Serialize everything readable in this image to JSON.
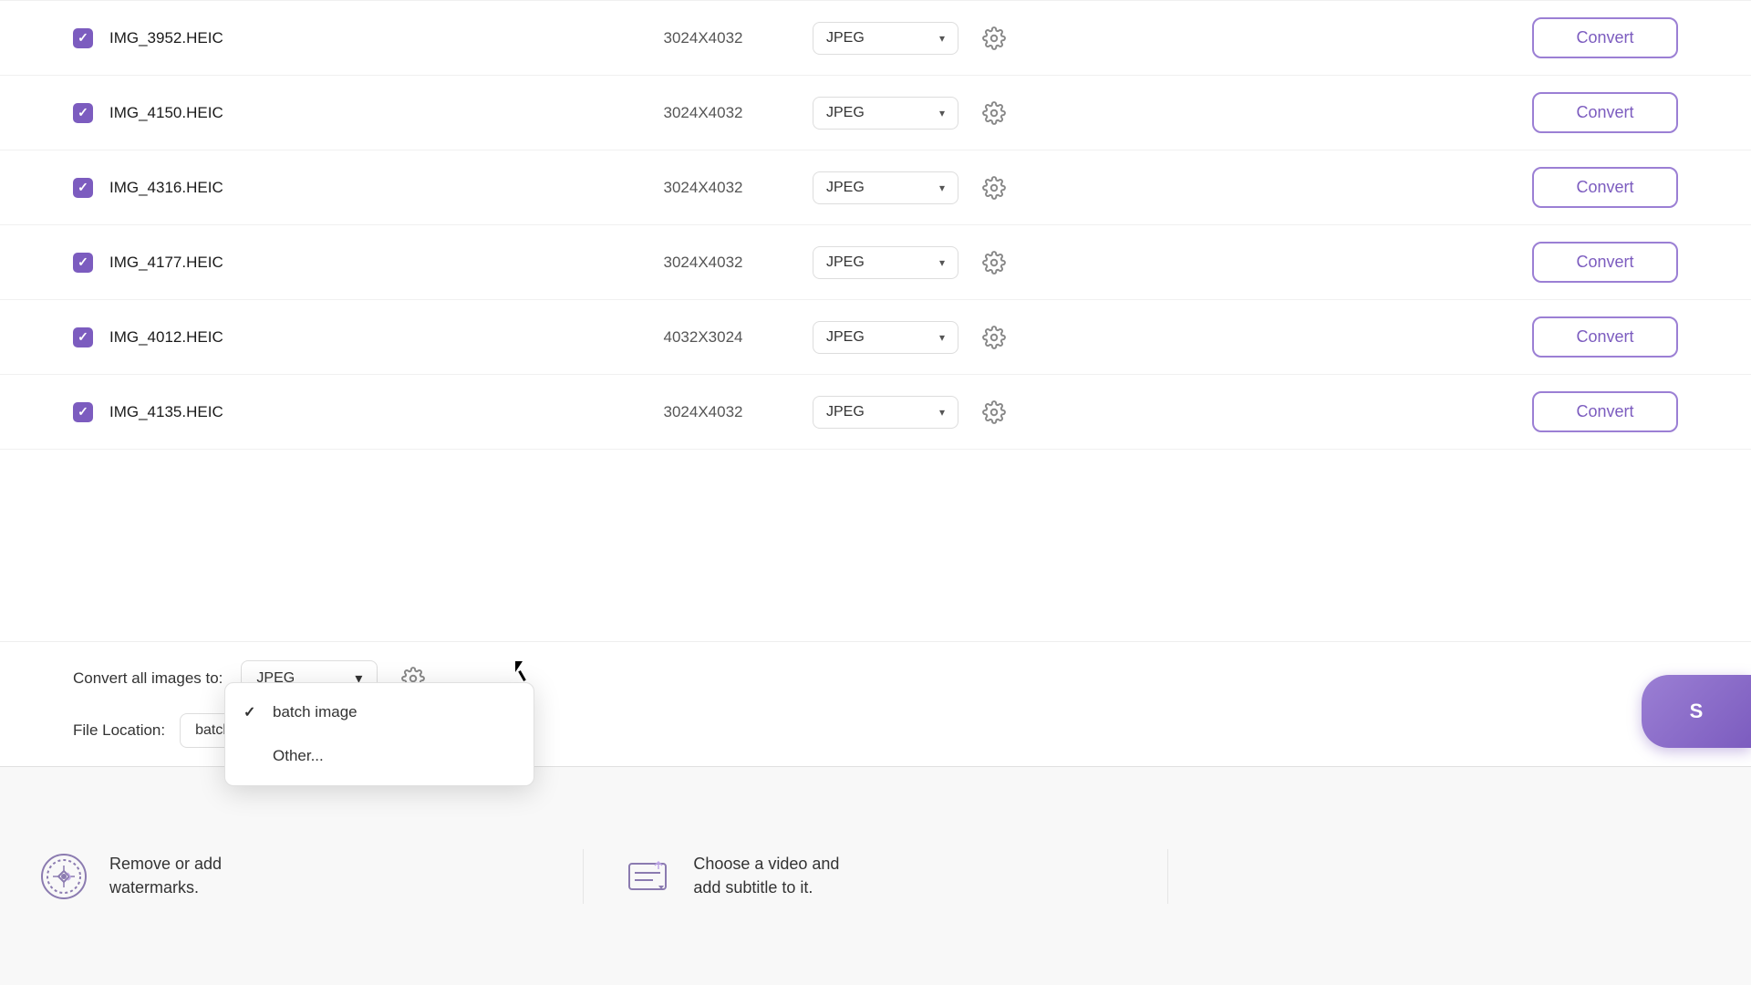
{
  "files": [
    {
      "id": 1,
      "name": "IMG_3952.HEIC",
      "dimensions": "3024X4032",
      "format": "JPEG"
    },
    {
      "id": 2,
      "name": "IMG_4150.HEIC",
      "dimensions": "3024X4032",
      "format": "JPEG"
    },
    {
      "id": 3,
      "name": "IMG_4316.HEIC",
      "dimensions": "3024X4032",
      "format": "JPEG"
    },
    {
      "id": 4,
      "name": "IMG_4177.HEIC",
      "dimensions": "3024X4032",
      "format": "JPEG"
    },
    {
      "id": 5,
      "name": "IMG_4012.HEIC",
      "dimensions": "4032X3024",
      "format": "JPEG"
    },
    {
      "id": 6,
      "name": "IMG_4135.HEIC",
      "dimensions": "3024X4032",
      "format": "JPEG"
    }
  ],
  "convert_button_label": "Convert",
  "toolbar": {
    "convert_all_label": "Convert all images to:",
    "format": "JPEG",
    "file_location_label": "File Location:",
    "location_value": "batch image"
  },
  "dropdown": {
    "options": [
      {
        "label": "batch image",
        "selected": true
      },
      {
        "label": "Other...",
        "selected": false
      }
    ]
  },
  "promo": [
    {
      "icon": "watermark-icon",
      "text": "Remove or add\nwatermarks."
    },
    {
      "icon": "subtitle-icon",
      "text": "Choose a video and\nadd subtitle to it."
    }
  ],
  "start_button_label": "S"
}
